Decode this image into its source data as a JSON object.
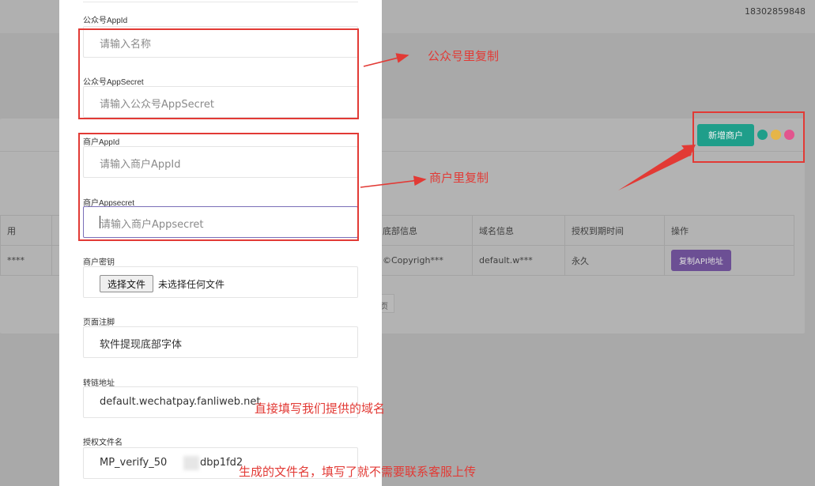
{
  "topbar": {
    "user_phone": "18302859848"
  },
  "actions": {
    "add_merchant_label": "新增商户"
  },
  "status_dots": [
    {
      "name": "teal",
      "color": "#1f9e8a"
    },
    {
      "name": "yellow",
      "color": "#e6b548"
    },
    {
      "name": "pink",
      "color": "#e2558e"
    }
  ],
  "table": {
    "headers": [
      "用",
      "",
      "底部信息",
      "域名信息",
      "授权到期时间",
      "操作"
    ],
    "row": {
      "cells": [
        "****",
        "",
        "©Copyrigh***",
        "default.w***",
        "永久"
      ],
      "action_label": "复制API地址"
    }
  },
  "pager": {
    "fragment": "页"
  },
  "form": {
    "appid": {
      "label": "公众号AppId",
      "placeholder": "请输入名称"
    },
    "appsecret": {
      "label": "公众号AppSecret",
      "placeholder": "请输入公众号AppSecret"
    },
    "merchant_appid": {
      "label": "商户AppId",
      "placeholder": "请输入商户AppId"
    },
    "merchant_appsecret": {
      "label": "商户Appsecret",
      "placeholder": "请输入商户Appsecret"
    },
    "merchant_key": {
      "label": "商户密钥",
      "button_label": "选择文件",
      "status": "未选择任何文件"
    },
    "footer_note": {
      "label": "页面注脚",
      "value": "软件提现底部字体"
    },
    "redirect_url": {
      "label": "转链地址",
      "value": "default.wechatpay.fanliweb.net"
    },
    "auth_file": {
      "label": "授权文件名",
      "value_prefix": "MP_verify_50",
      "value_suffix": "dbp1fd2"
    }
  },
  "annotations": {
    "copy_from_official": "公众号里复制",
    "copy_from_merchant": "商户里复制",
    "fill_domain": "直接填写我们提供的域名",
    "file_name_note": "生成的文件名，填写了就不需要联系客服上传"
  }
}
